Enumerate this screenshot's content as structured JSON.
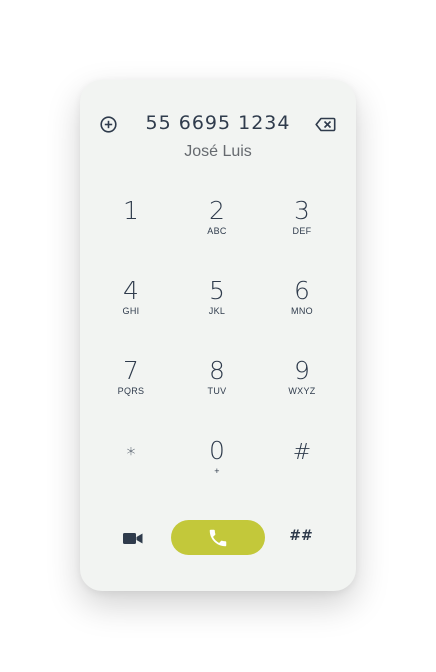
{
  "dialer": {
    "number": "55 6695 1234",
    "contact_name": "José Luis",
    "keys": [
      {
        "digit": "1",
        "letters": ""
      },
      {
        "digit": "2",
        "letters": "ABC"
      },
      {
        "digit": "3",
        "letters": "DEF"
      },
      {
        "digit": "4",
        "letters": "GHI"
      },
      {
        "digit": "5",
        "letters": "JKL"
      },
      {
        "digit": "6",
        "letters": "MNO"
      },
      {
        "digit": "7",
        "letters": "PQRS"
      },
      {
        "digit": "8",
        "letters": "TUV"
      },
      {
        "digit": "9",
        "letters": "WXYZ"
      },
      {
        "digit": "*",
        "letters": ""
      },
      {
        "digit": "0",
        "letters": "+"
      },
      {
        "digit": "#",
        "letters": ""
      }
    ],
    "bottom": {
      "video_icon": "video-camera-icon",
      "call_icon": "phone-icon",
      "hash_label": "##"
    }
  },
  "icons": {
    "add": "plus-circle-icon",
    "backspace": "backspace-icon"
  },
  "colors": {
    "card_background": "#f2f4f2",
    "text": "#2f3b4c",
    "contact_text": "#666a6f",
    "call_button": "#c3c83a",
    "call_icon": "#ffffff"
  }
}
